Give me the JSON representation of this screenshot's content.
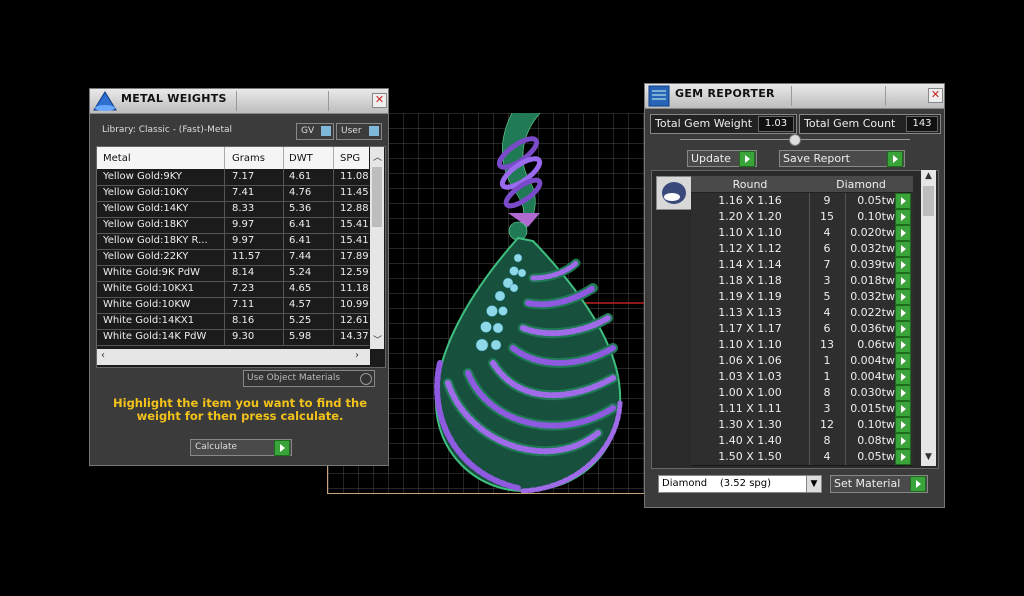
{
  "metal_weights": {
    "title": "METAL WEIGHTS",
    "library_label": "Library: Classic - (Fast)-Metal",
    "gv_label": "GV",
    "user_label": "User",
    "columns": [
      "Metal",
      "Grams",
      "DWT",
      "SPG"
    ],
    "rows": [
      {
        "metal": "Yellow Gold:9KY",
        "grams": "7.17",
        "dwt": "4.61",
        "spg": "11.08"
      },
      {
        "metal": "Yellow Gold:10KY",
        "grams": "7.41",
        "dwt": "4.76",
        "spg": "11.45"
      },
      {
        "metal": "Yellow Gold:14KY",
        "grams": "8.33",
        "dwt": "5.36",
        "spg": "12.88"
      },
      {
        "metal": "Yellow Gold:18KY",
        "grams": "9.97",
        "dwt": "6.41",
        "spg": "15.41"
      },
      {
        "metal": "Yellow Gold:18KY R...",
        "grams": "9.97",
        "dwt": "6.41",
        "spg": "15.41"
      },
      {
        "metal": "Yellow Gold:22KY",
        "grams": "11.57",
        "dwt": "7.44",
        "spg": "17.89"
      },
      {
        "metal": "White Gold:9K PdW",
        "grams": "8.14",
        "dwt": "5.24",
        "spg": "12.59"
      },
      {
        "metal": "White Gold:10KX1",
        "grams": "7.23",
        "dwt": "4.65",
        "spg": "11.18"
      },
      {
        "metal": "White Gold:10KW",
        "grams": "7.11",
        "dwt": "4.57",
        "spg": "10.99"
      },
      {
        "metal": "White Gold:14KX1",
        "grams": "8.16",
        "dwt": "5.25",
        "spg": "12.61"
      },
      {
        "metal": "White Gold:14K PdW",
        "grams": "9.30",
        "dwt": "5.98",
        "spg": "14.37"
      }
    ],
    "use_object_materials": "Use Object Materials",
    "instruction": "Highlight the item you want to find the weight for then press calculate.",
    "calculate_label": "Calculate"
  },
  "gem_reporter": {
    "title": "GEM REPORTER",
    "total_weight_label": "Total Gem Weight",
    "total_weight_value": "1.03",
    "total_count_label": "Total Gem Count",
    "total_count_value": "143",
    "update_label": "Update",
    "save_report_label": "Save Report",
    "columns": [
      "Round",
      "Diamond"
    ],
    "rows": [
      {
        "size": "1.16 X 1.16",
        "count": "9",
        "tw": "0.05tw"
      },
      {
        "size": "1.20 X 1.20",
        "count": "15",
        "tw": "0.10tw"
      },
      {
        "size": "1.10 X 1.10",
        "count": "4",
        "tw": "0.020tw"
      },
      {
        "size": "1.12 X 1.12",
        "count": "6",
        "tw": "0.032tw"
      },
      {
        "size": "1.14 X 1.14",
        "count": "7",
        "tw": "0.039tw"
      },
      {
        "size": "1.18 X 1.18",
        "count": "3",
        "tw": "0.018tw"
      },
      {
        "size": "1.19 X 1.19",
        "count": "5",
        "tw": "0.032tw"
      },
      {
        "size": "1.13 X 1.13",
        "count": "4",
        "tw": "0.022tw"
      },
      {
        "size": "1.17 X 1.17",
        "count": "6",
        "tw": "0.036tw"
      },
      {
        "size": "1.10 X 1.10",
        "count": "13",
        "tw": "0.06tw"
      },
      {
        "size": "1.06 X 1.06",
        "count": "1",
        "tw": "0.004tw"
      },
      {
        "size": "1.03 X 1.03",
        "count": "1",
        "tw": "0.004tw"
      },
      {
        "size": "1.00 X 1.00",
        "count": "8",
        "tw": "0.030tw"
      },
      {
        "size": "1.11 X 1.11",
        "count": "3",
        "tw": "0.015tw"
      },
      {
        "size": "1.30 X 1.30",
        "count": "12",
        "tw": "0.10tw"
      },
      {
        "size": "1.40 X 1.40",
        "count": "8",
        "tw": "0.08tw"
      },
      {
        "size": "1.50 X 1.50",
        "count": "4",
        "tw": "0.05tw"
      }
    ],
    "material_select": "Diamond    (3.52 spg)",
    "set_material_label": "Set Material"
  },
  "colors": {
    "panel_bg": "#3b3b3b",
    "accent_green": "#3aa43a",
    "instruction_yellow": "#f2c21a",
    "gem_purple": "#9a5bd6",
    "metal_green": "#1f8a5a"
  }
}
